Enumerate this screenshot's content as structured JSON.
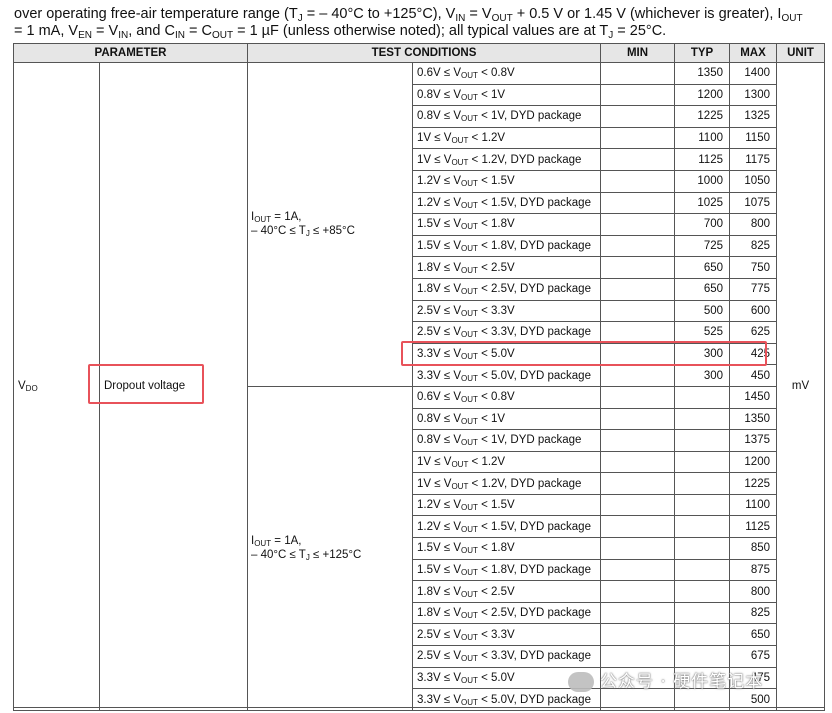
{
  "intro": {
    "line1_pre": "over operating free-air temperature range (T",
    "tj_sub": "J",
    "line1_mid": " = – 40°C to +125°C), V",
    "vin_sub": "IN",
    "line1_b": " = V",
    "vout_sub": "OUT",
    "line1_c": " + 0.5 V or 1.45 V (whichever is greater), I",
    "iout_sub": "OUT",
    "line2_a": " = 1 mA, V",
    "ven_sub": "EN",
    "line2_b": " = V",
    "vin2_sub": "IN",
    "line2_c": ", and C",
    "cin_sub": "IN",
    "line2_d": " = C",
    "cout_sub": "OUT",
    "line2_e": " = 1 µF (unless otherwise noted); all typical values are at T",
    "tj2_sub": "J",
    "line2_f": " = 25°C."
  },
  "table": {
    "headers": {
      "parameter": "PARAMETER",
      "test_conditions": "TEST CONDITIONS",
      "min": "MIN",
      "typ": "TYP",
      "max": "MAX",
      "unit": "UNIT"
    },
    "symbol": "V",
    "symbol_sub": "DO",
    "parameter_name": "Dropout voltage",
    "unit": "mV",
    "group1": {
      "l1a": "I",
      "l1sub": "OUT",
      "l1b": " = 1A,",
      "l2a": "– 40°C ≤ T",
      "l2sub": "J",
      "l2b": " ≤ +85°C"
    },
    "group2": {
      "l1a": "I",
      "l1sub": "OUT",
      "l1b": " = 1A,",
      "l2a": "– 40°C ≤ T",
      "l2sub": "J",
      "l2b": " ≤ +125°C"
    },
    "rows1": [
      {
        "lo": "0.6V ≤ V",
        "hi": " < 0.8V",
        "pkg": "",
        "min": "",
        "typ": "1350",
        "max": "1400"
      },
      {
        "lo": "0.8V ≤ V",
        "hi": " < 1V",
        "pkg": "",
        "min": "",
        "typ": "1200",
        "max": "1300"
      },
      {
        "lo": "0.8V ≤ V",
        "hi": " < 1V, DYD package",
        "pkg": "",
        "min": "",
        "typ": "1225",
        "max": "1325"
      },
      {
        "lo": "1V ≤ V",
        "hi": " < 1.2V",
        "pkg": "",
        "min": "",
        "typ": "1100",
        "max": "1150"
      },
      {
        "lo": "1V ≤ V",
        "hi": " < 1.2V, DYD package",
        "pkg": "",
        "min": "",
        "typ": "1125",
        "max": "1175"
      },
      {
        "lo": "1.2V ≤ V",
        "hi": " < 1.5V",
        "pkg": "",
        "min": "",
        "typ": "1000",
        "max": "1050"
      },
      {
        "lo": "1.2V ≤ V",
        "hi": " < 1.5V, DYD package",
        "pkg": "",
        "min": "",
        "typ": "1025",
        "max": "1075"
      },
      {
        "lo": "1.5V ≤ V",
        "hi": " < 1.8V",
        "pkg": "",
        "min": "",
        "typ": "700",
        "max": "800"
      },
      {
        "lo": "1.5V ≤ V",
        "hi": " < 1.8V, DYD package",
        "pkg": "",
        "min": "",
        "typ": "725",
        "max": "825"
      },
      {
        "lo": "1.8V ≤ V",
        "hi": " < 2.5V",
        "pkg": "",
        "min": "",
        "typ": "650",
        "max": "750"
      },
      {
        "lo": "1.8V ≤ V",
        "hi": " < 2.5V, DYD package",
        "pkg": "",
        "min": "",
        "typ": "650",
        "max": "775"
      },
      {
        "lo": "2.5V ≤ V",
        "hi": " < 3.3V",
        "pkg": "",
        "min": "",
        "typ": "500",
        "max": "600"
      },
      {
        "lo": "2.5V ≤ V",
        "hi": " < 3.3V, DYD package",
        "pkg": "",
        "min": "",
        "typ": "525",
        "max": "625"
      },
      {
        "lo": "3.3V ≤ V",
        "hi": " < 5.0V",
        "pkg": "",
        "min": "",
        "typ": "300",
        "max": "425"
      },
      {
        "lo": "3.3V ≤ V",
        "hi": " < 5.0V, DYD package",
        "pkg": "",
        "min": "",
        "typ": "300",
        "max": "450"
      }
    ],
    "rows2": [
      {
        "lo": "0.6V ≤ V",
        "hi": " < 0.8V",
        "min": "",
        "typ": "",
        "max": "1450"
      },
      {
        "lo": "0.8V ≤ V",
        "hi": " < 1V",
        "min": "",
        "typ": "",
        "max": "1350"
      },
      {
        "lo": "0.8V ≤ V",
        "hi": " < 1V, DYD package",
        "min": "",
        "typ": "",
        "max": "1375"
      },
      {
        "lo": "1V ≤ V",
        "hi": " < 1.2V",
        "min": "",
        "typ": "",
        "max": "1200"
      },
      {
        "lo": "1V ≤ V",
        "hi": " < 1.2V, DYD package",
        "min": "",
        "typ": "",
        "max": "1225"
      },
      {
        "lo": "1.2V ≤ V",
        "hi": " < 1.5V",
        "min": "",
        "typ": "",
        "max": "1100"
      },
      {
        "lo": "1.2V ≤ V",
        "hi": " < 1.5V, DYD package",
        "min": "",
        "typ": "",
        "max": "1125"
      },
      {
        "lo": "1.5V ≤ V",
        "hi": " < 1.8V",
        "min": "",
        "typ": "",
        "max": "850"
      },
      {
        "lo": "1.5V ≤ V",
        "hi": " < 1.8V, DYD package",
        "min": "",
        "typ": "",
        "max": "875"
      },
      {
        "lo": "1.8V ≤ V",
        "hi": " < 2.5V",
        "min": "",
        "typ": "",
        "max": "800"
      },
      {
        "lo": "1.8V ≤ V",
        "hi": " < 2.5V, DYD package",
        "min": "",
        "typ": "",
        "max": "825"
      },
      {
        "lo": "2.5V ≤ V",
        "hi": " < 3.3V",
        "min": "",
        "typ": "",
        "max": "650"
      },
      {
        "lo": "2.5V ≤ V",
        "hi": " < 3.3V, DYD package",
        "min": "",
        "typ": "",
        "max": "675"
      },
      {
        "lo": "3.3V ≤ V",
        "hi": " < 5.0V",
        "min": "",
        "typ": "",
        "max": "475"
      },
      {
        "lo": "3.3V ≤ V",
        "hi": " < 5.0V, DYD package",
        "min": "",
        "typ": "",
        "max": "500"
      }
    ],
    "vout_sub": "OUT"
  },
  "highlight_color": "#e8525a",
  "watermark": {
    "text": "公众号 · 硬件笔记本",
    "icon": "wechat-bubble-icon"
  }
}
